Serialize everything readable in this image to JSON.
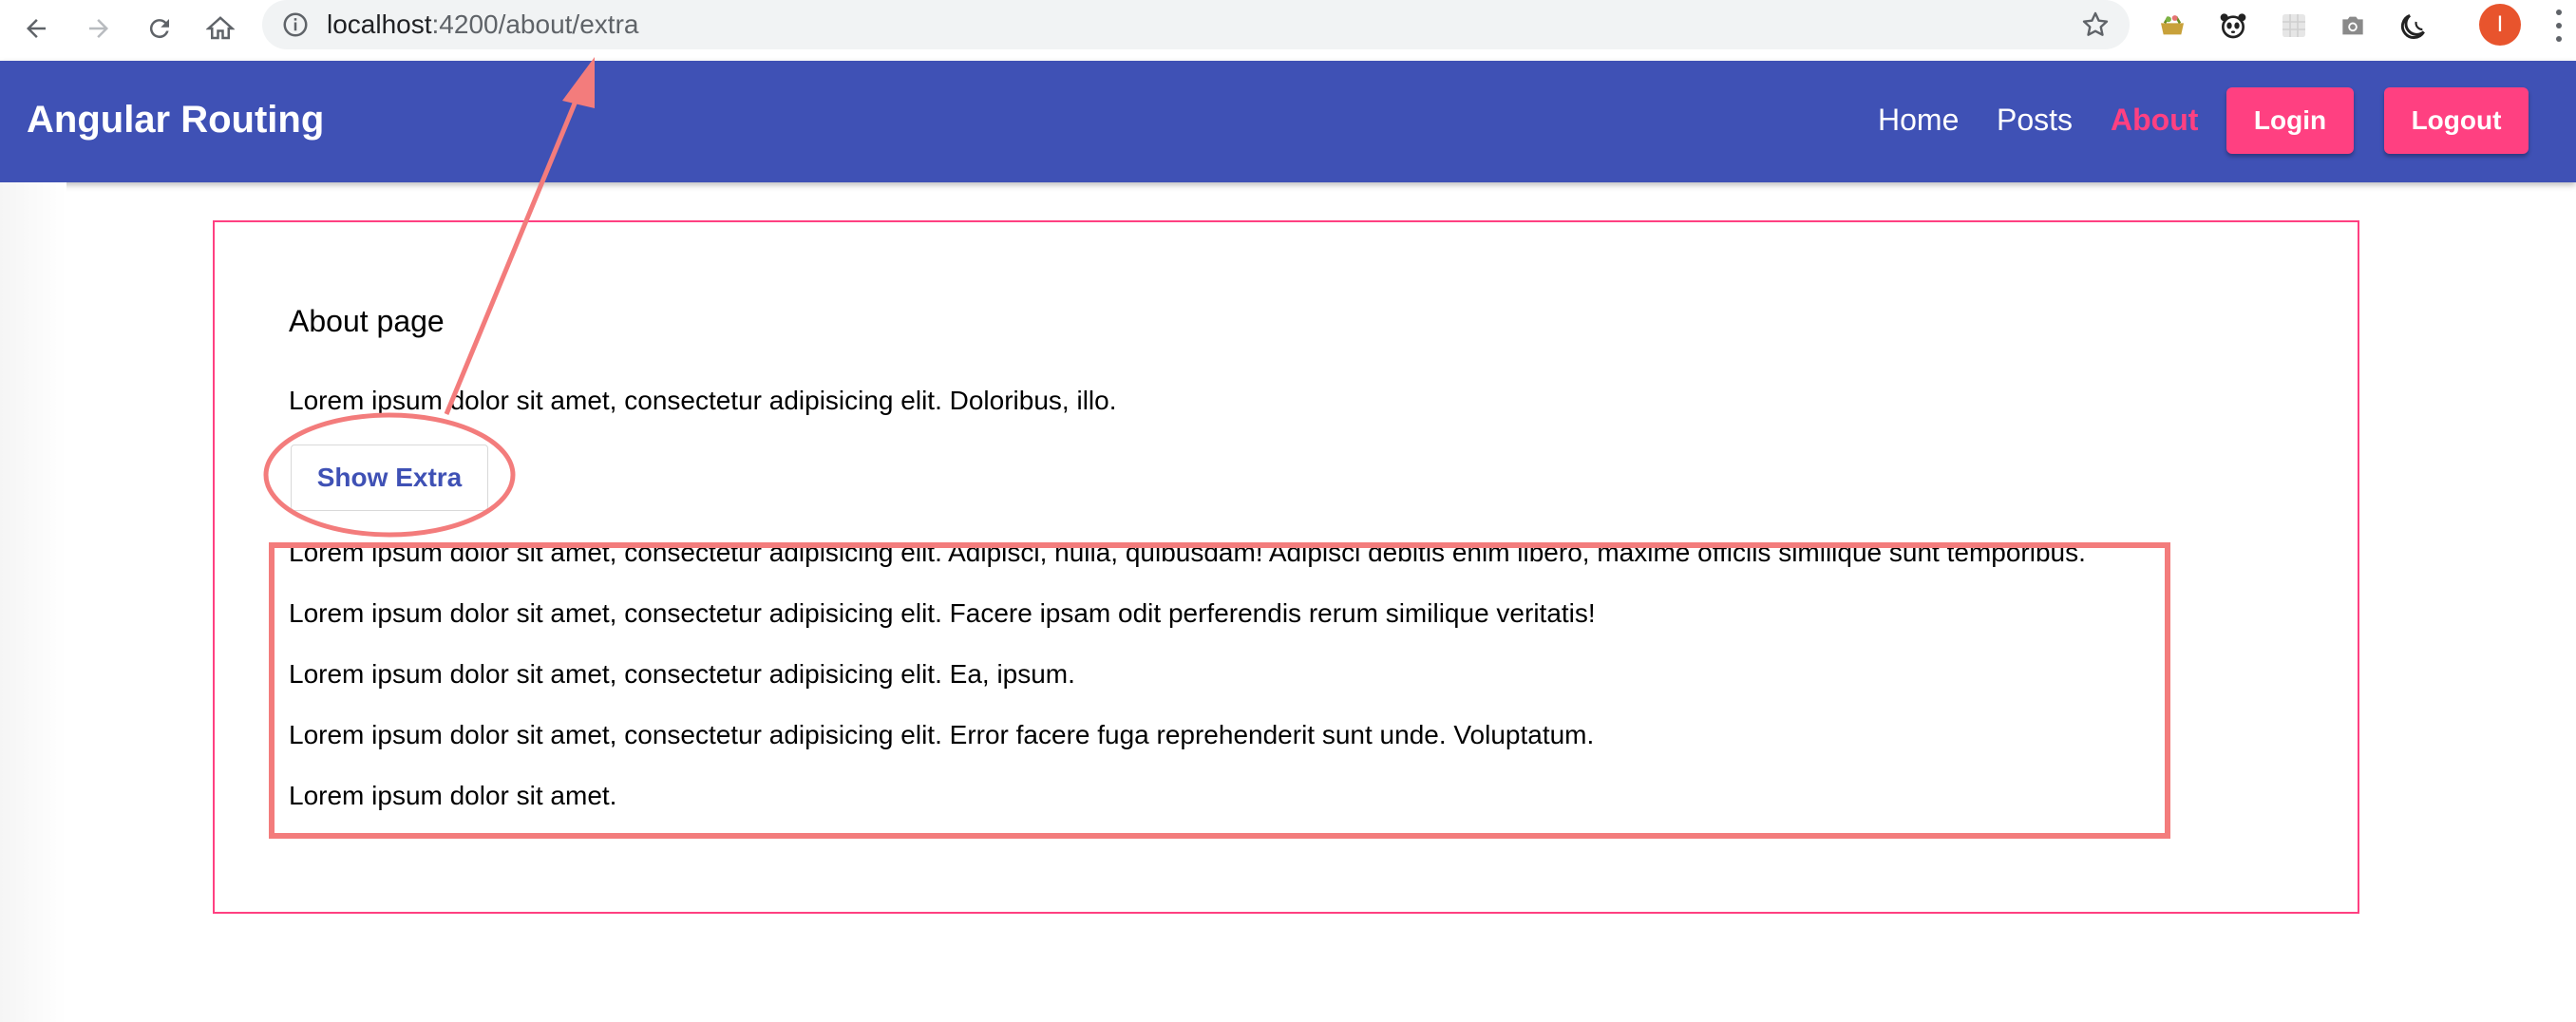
{
  "browser": {
    "url_host": "localhost",
    "url_path": ":4200/about/extra",
    "profile_initial": "I",
    "extensions": [
      "basket-icon",
      "panda-icon",
      "grid-icon",
      "camera-icon",
      "moon-icon"
    ]
  },
  "toolbar": {
    "title": "Angular Routing",
    "nav": [
      {
        "label": "Home",
        "active": false
      },
      {
        "label": "Posts",
        "active": false
      },
      {
        "label": "About",
        "active": true
      }
    ],
    "login_label": "Login",
    "logout_label": "Logout"
  },
  "page": {
    "heading": "About page",
    "intro": "Lorem ipsum dolor sit amet, consectetur adipisicing elit. Doloribus, illo.",
    "button_label": "Show Extra",
    "extra": [
      "Lorem ipsum dolor sit amet, consectetur adipisicing elit. Adipisci, nulla, quibusdam! Adipisci debitis enim libero, maxime officiis similique sunt temporibus.",
      "Lorem ipsum dolor sit amet, consectetur adipisicing elit. Facere ipsam odit perferendis rerum similique veritatis!",
      "Lorem ipsum dolor sit amet, consectetur adipisicing elit. Ea, ipsum.",
      "Lorem ipsum dolor sit amet, consectetur adipisicing elit. Error facere fuga reprehenderit sunt unde. Voluptatum.",
      "Lorem ipsum dolor sit amet."
    ]
  },
  "colors": {
    "primary": "#3f51b5",
    "accent": "#ff4081",
    "annotation": "#f37c7c"
  }
}
